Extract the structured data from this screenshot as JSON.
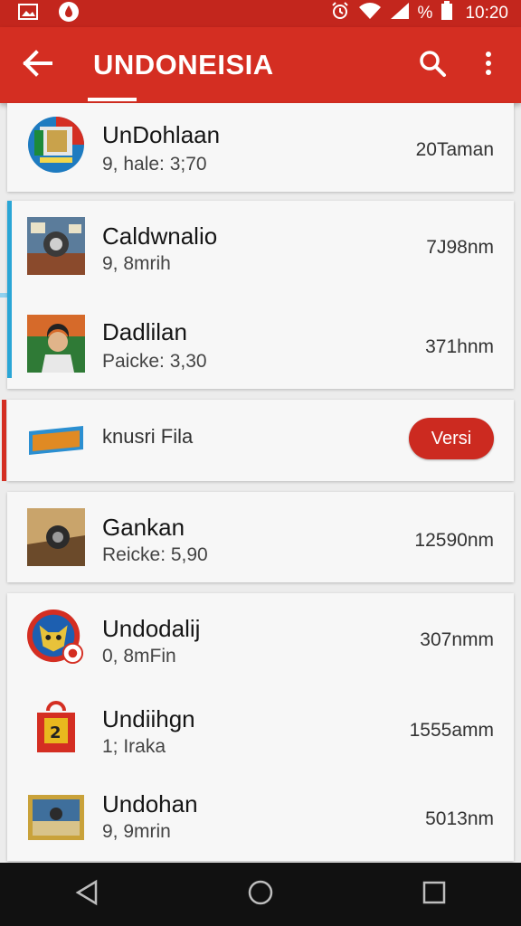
{
  "status_bar": {
    "icons": [
      "image-icon",
      "drop-icon",
      "alarm-icon",
      "wifi-icon",
      "signal-icon",
      "battery-icon"
    ],
    "battery_text": "%",
    "time": "10:20"
  },
  "app_bar": {
    "title": "UNDONEISIA",
    "background": "#d42e22",
    "actions": [
      "back-arrow-icon",
      "search-icon",
      "more-vert-icon"
    ]
  },
  "items": [
    {
      "title": "UnDohlaan",
      "subtitle": "9, hale: 3;70",
      "size": "20Taman"
    },
    {
      "title": "Caldwnalio",
      "subtitle": "9, 8mrih",
      "size": "7J98nm"
    },
    {
      "title": "Dadlilan",
      "subtitle": "Paicke: 3,30",
      "size": "371hnm"
    },
    {
      "title": "knusri Fila",
      "button": "Versi"
    },
    {
      "title": "Gankan",
      "subtitle": "Reicke: 5,90",
      "size": "12590nm"
    },
    {
      "title": "Undodalij",
      "subtitle": "0, 8mFin",
      "size": "307nmm"
    },
    {
      "title": "Undiihgn",
      "subtitle": "1; Iraka",
      "size": "1555amm"
    },
    {
      "title": "Undohan",
      "subtitle": "9, 9mrin",
      "size": "5013nm"
    }
  ],
  "colors": {
    "accent_red": "#d42e22",
    "accent_blue": "#2aa6d6",
    "button_red": "#cc2a20"
  },
  "nav": [
    "back-triangle-icon",
    "home-circle-icon",
    "recents-square-icon"
  ]
}
